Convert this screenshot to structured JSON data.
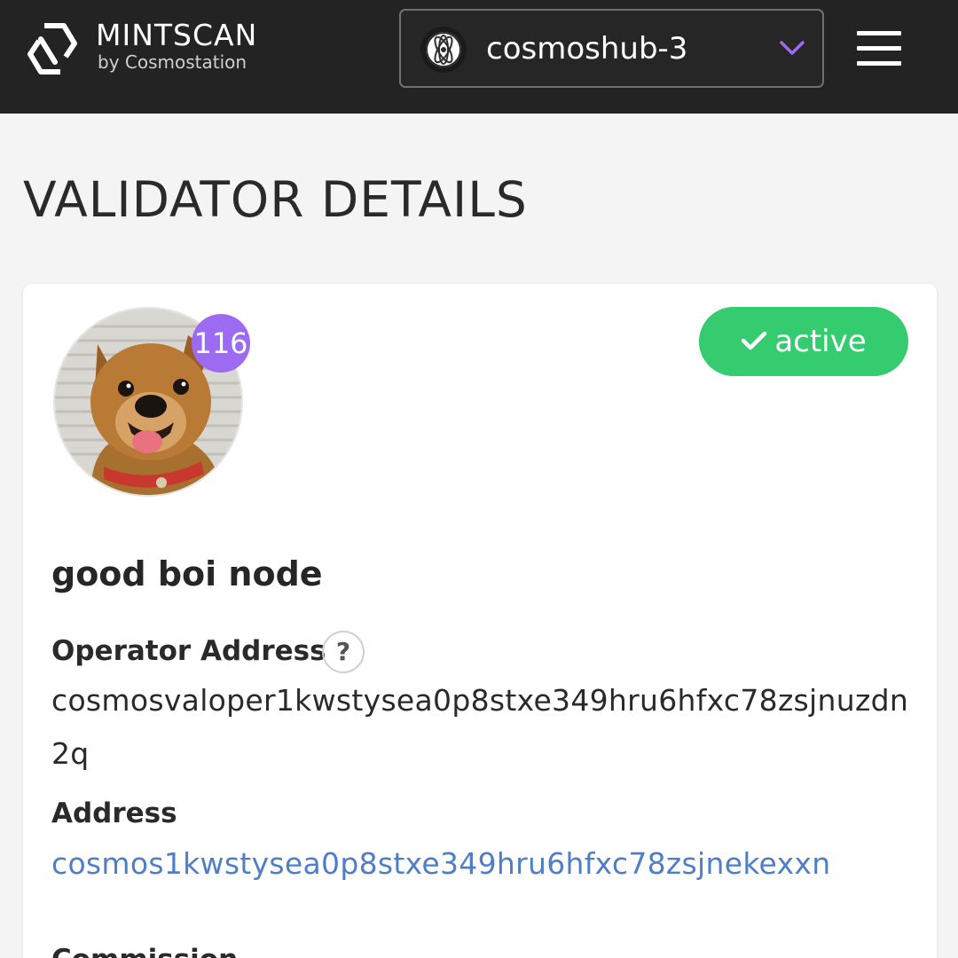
{
  "header": {
    "brand_title": "MINTSCAN",
    "brand_subtitle": "by Cosmostation",
    "chain_name": "cosmoshub-3",
    "accent_color": "#9c6bf2"
  },
  "page": {
    "title": "VALIDATOR DETAILS"
  },
  "validator": {
    "rank": "116",
    "status": "active",
    "status_color": "#35cb6f",
    "name": "good boi node",
    "operator_address_label": "Operator Address",
    "operator_address": "cosmosvaloper1kwstysea0p8stxe349hru6hfxc78zsjnuzdn2q",
    "help_icon_glyph": "?",
    "address_label": "Address",
    "address": "cosmos1kwstysea0p8stxe349hru6hfxc78zsjnekexxn",
    "next_label": "Commission"
  },
  "icons": {
    "logo": "mintscan-logo-icon",
    "chain": "cosmos-atom-icon",
    "dropdown": "chevron-down-icon",
    "menu": "hamburger-menu-icon",
    "status": "checkmark-icon",
    "help": "help-question-icon"
  }
}
